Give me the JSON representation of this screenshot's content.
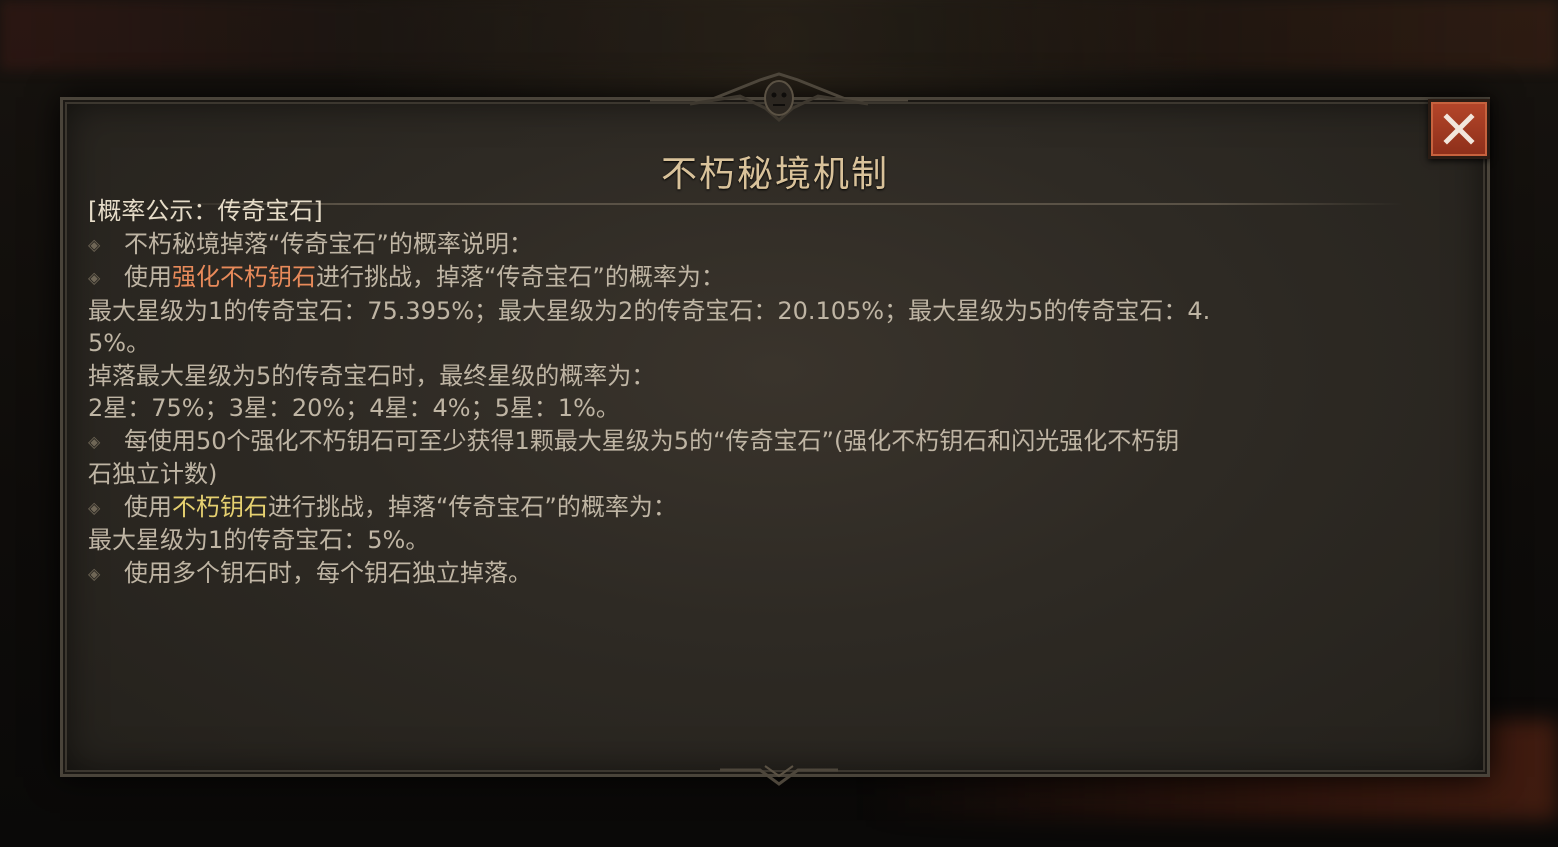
{
  "dialog": {
    "title": "不朽秘境机制"
  },
  "close_button": {
    "icon": "close-icon"
  },
  "content": {
    "heading": "[概率公示：传奇宝石]",
    "bullet1": "不朽秘境掉落“传奇宝石”的概率说明：",
    "bullet2": {
      "prefix": "使用",
      "highlight": "强化不朽钥石",
      "suffix": "进行挑战，掉落“传奇宝石”的概率为："
    },
    "rates_line1": "最大星级为1的传奇宝石：75.395%；最大星级为2的传奇宝石：20.105%；最大星级为5的传奇宝石：4.",
    "rates_line2": "5%。",
    "star_intro": "掉落最大星级为5的传奇宝石时，最终星级的概率为：",
    "star_rates": "2星：75%；3星：20%；4星：4%；5星：1%。",
    "bullet3_line1": "每使用50个强化不朽钥石可至少获得1颗最大星级为5的“传奇宝石”(强化不朽钥石和闪光强化不朽钥",
    "bullet3_line2": "石独立计数)",
    "bullet4": {
      "prefix": "使用",
      "highlight": "不朽钥石",
      "suffix": "进行挑战，掉落“传奇宝石”的概率为："
    },
    "basic_rate": "最大星级为1的传奇宝石：5%。",
    "bullet5": "使用多个钥石时，每个钥石独立掉落。"
  },
  "colors": {
    "orange_highlight": "#e88a5a",
    "yellow_highlight": "#e5d070",
    "title": "#d9c29a",
    "body_text": "#bfb5a4",
    "close_button": "#b5462a"
  }
}
